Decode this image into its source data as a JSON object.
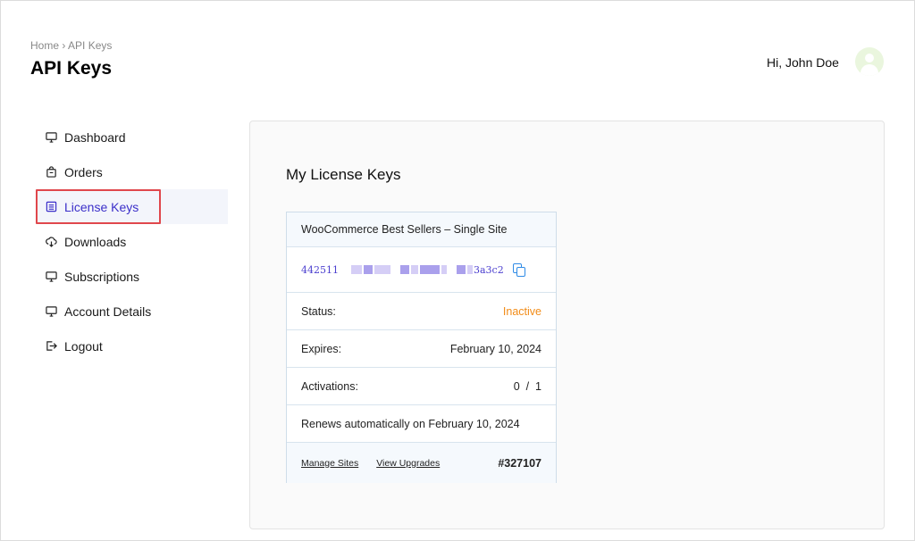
{
  "header": {
    "breadcrumb_home": "Home",
    "breadcrumb_sep": "›",
    "breadcrumb_current": "API Keys",
    "title": "API Keys",
    "greeting": "Hi, John Doe",
    "avatar_icon": "user-avatar-icon"
  },
  "sidebar": {
    "items": [
      {
        "label": "Dashboard",
        "icon": "monitor-icon"
      },
      {
        "label": "Orders",
        "icon": "bag-icon"
      },
      {
        "label": "License Keys",
        "icon": "list-icon",
        "active": true
      },
      {
        "label": "Downloads",
        "icon": "cloud-download-icon"
      },
      {
        "label": "Subscriptions",
        "icon": "monitor-icon"
      },
      {
        "label": "Account Details",
        "icon": "monitor-icon"
      },
      {
        "label": "Logout",
        "icon": "logout-icon"
      }
    ]
  },
  "main": {
    "title": "My License Keys",
    "license": {
      "product": "WooCommerce Best Sellers – Single Site",
      "key_start": "442511",
      "key_end": "3a3c2",
      "status_label": "Status:",
      "status_value": "Inactive",
      "expires_label": "Expires:",
      "expires_value": "February 10, 2024",
      "activations_label": "Activations:",
      "activations_used": "0",
      "activations_sep": "/",
      "activations_total": "1",
      "renewal_text": "Renews automatically on February 10, 2024",
      "manage_sites": "Manage Sites",
      "view_upgrades": "View Upgrades",
      "order_number": "#327107"
    }
  },
  "colors": {
    "accent": "#3b2fc9",
    "status_inactive": "#f28c18",
    "highlight_border": "#e0474c",
    "copy_icon": "#2f8be6"
  }
}
